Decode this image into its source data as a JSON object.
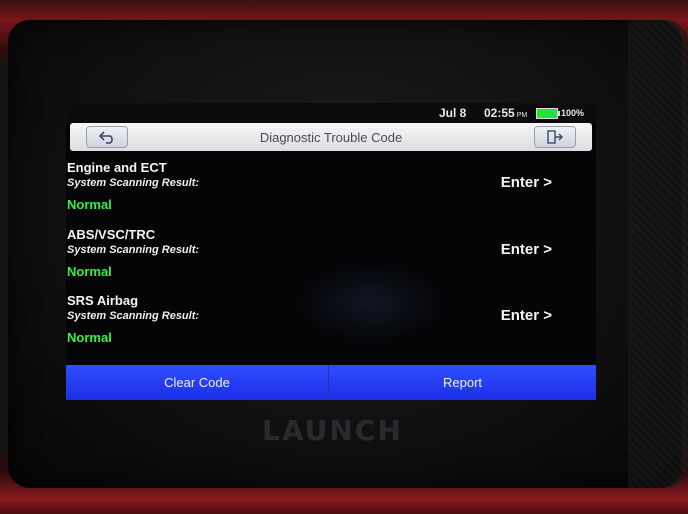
{
  "device": {
    "brand": "LAUNCH"
  },
  "statusbar": {
    "date": "Jul 8",
    "time": "02:55",
    "ampm": "PM",
    "battery": "100%",
    "battery_color": "#25e03a"
  },
  "header": {
    "title": "Diagnostic Trouble Code"
  },
  "systems": [
    {
      "name": "Engine and ECT",
      "subtitle": "System Scanning Result:",
      "status": "Normal",
      "action": "Enter >"
    },
    {
      "name": "ABS/VSC/TRC",
      "subtitle": "System Scanning Result:",
      "status": "Normal",
      "action": "Enter >"
    },
    {
      "name": "SRS Airbag",
      "subtitle": "System Scanning Result:",
      "status": "Normal",
      "action": "Enter >"
    }
  ],
  "footer": {
    "clear_label": "Clear Code",
    "report_label": "Report"
  },
  "colors": {
    "accent": "#2f4dff",
    "status_ok": "#33f04a"
  },
  "icons": {
    "back": "back-arrow-icon",
    "exit": "exit-door-icon"
  }
}
